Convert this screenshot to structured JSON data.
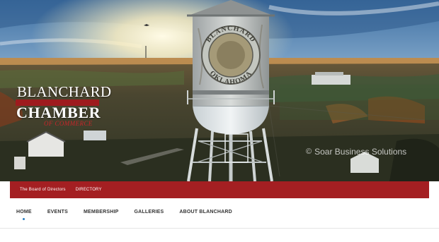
{
  "logo": {
    "line1": "BLANCHARD",
    "line2": "CHAMBER",
    "line3": "OF COMMERCE"
  },
  "tower_text": {
    "top": "BLANCHARD",
    "bottom": "OKLAHOMA"
  },
  "watermark": {
    "icon": "copyright-icon",
    "text": "Soar Business Solutions"
  },
  "top_links": [
    {
      "label": "The Board of Directors"
    },
    {
      "label": "DIRECTORY"
    }
  ],
  "main_nav": [
    {
      "label": "HOME",
      "active": true
    },
    {
      "label": "EVENTS",
      "active": false
    },
    {
      "label": "MEMBERSHIP",
      "active": false
    },
    {
      "label": "GALLERIES",
      "active": false
    },
    {
      "label": "ABOUT BLANCHARD",
      "active": false
    }
  ],
  "colors": {
    "brand_red": "#a41f22",
    "nav_text": "#333333",
    "active_dot": "#2a7fc1"
  }
}
